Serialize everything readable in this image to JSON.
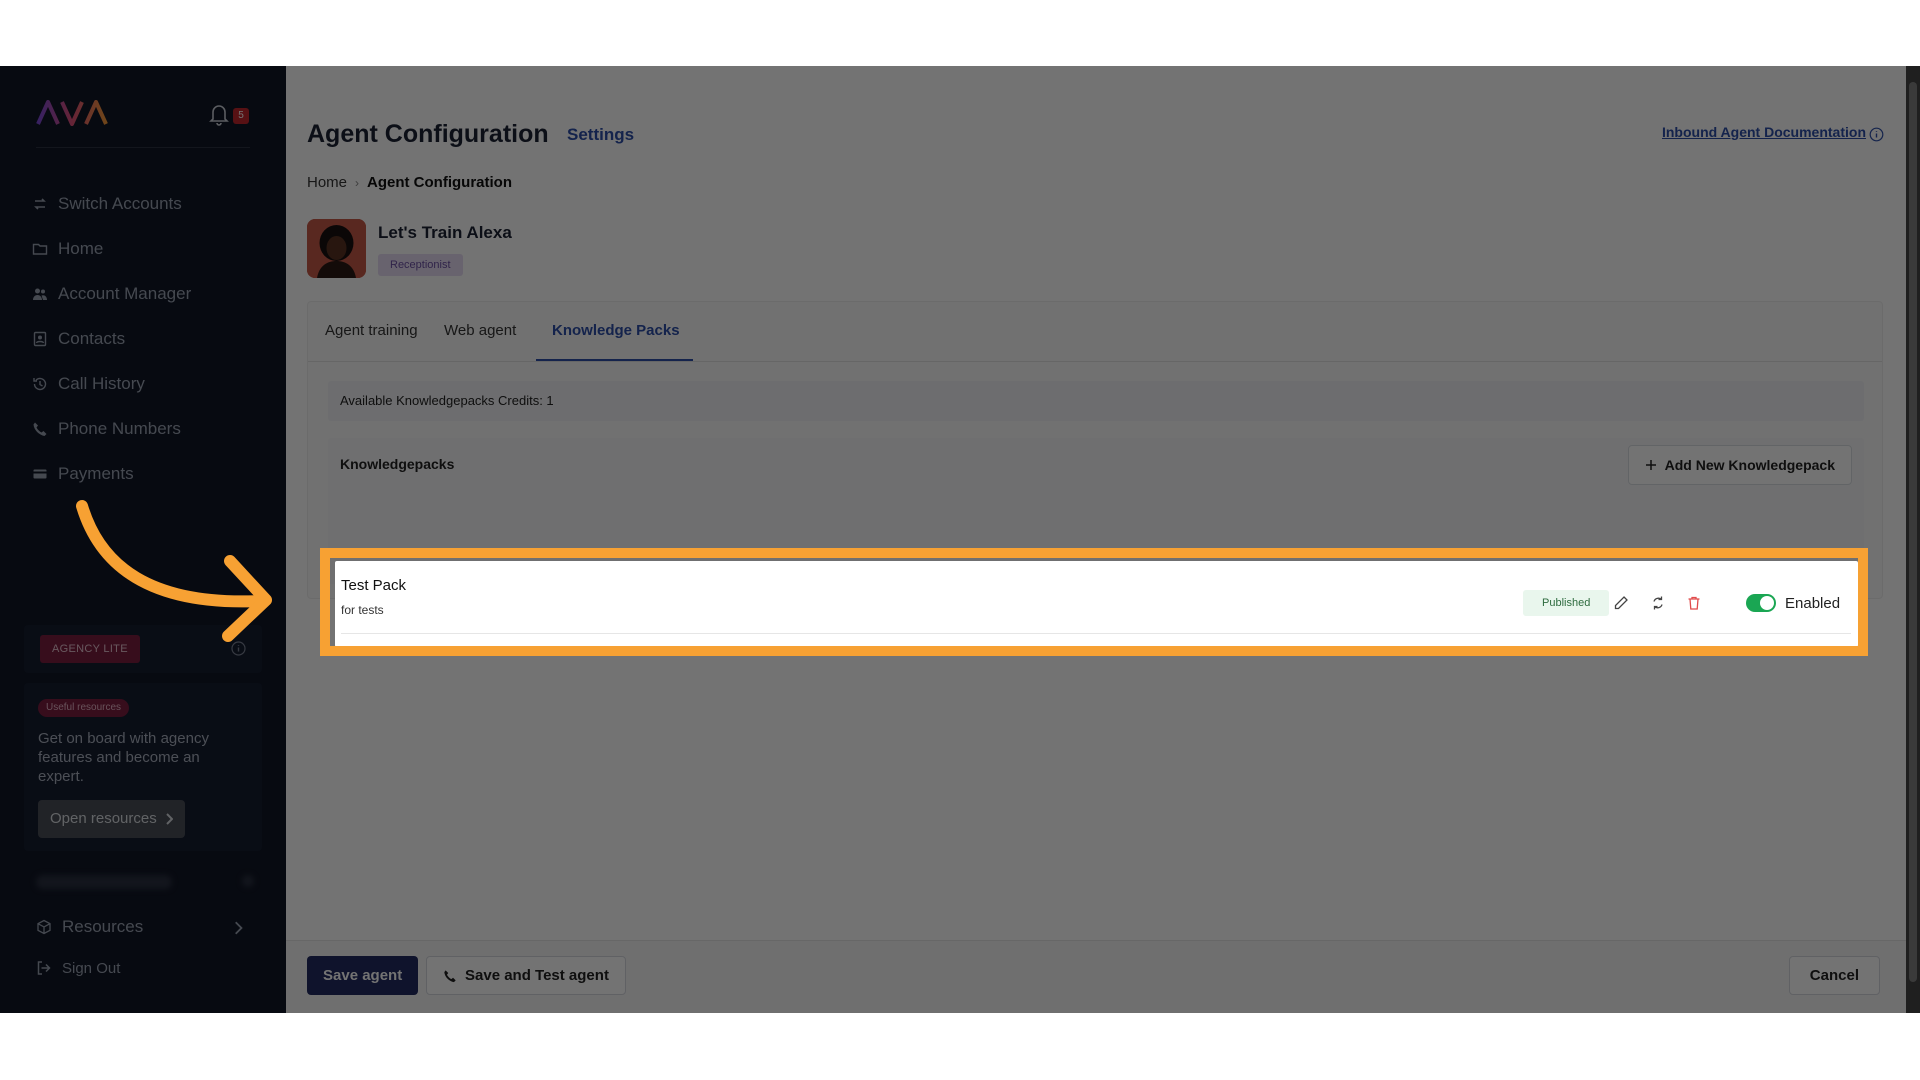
{
  "brand": {
    "logo_text": "AVA",
    "accent": "#f7a133",
    "primary": "#232b63",
    "link": "#2d4fa8"
  },
  "notifications": {
    "count": "5"
  },
  "sidebar": {
    "items": [
      {
        "label": "Switch Accounts",
        "icon": "switch-icon"
      },
      {
        "label": "Home",
        "icon": "folder-icon"
      },
      {
        "label": "Account Manager",
        "icon": "users-icon"
      },
      {
        "label": "Contacts",
        "icon": "contacts-icon"
      },
      {
        "label": "Call History",
        "icon": "history-icon"
      },
      {
        "label": "Phone Numbers",
        "icon": "phone-icon"
      },
      {
        "label": "Payments",
        "icon": "card-icon"
      }
    ],
    "plan_badge": "AGENCY LITE",
    "resources_card": {
      "badge": "Useful resources",
      "text": "Get on board with agency features and become an expert.",
      "button": "Open resources"
    },
    "resources": "Resources",
    "sign_out": "Sign Out"
  },
  "header": {
    "title": "Agent Configuration",
    "subtitle": "Settings",
    "doc_link": "Inbound Agent Documentation"
  },
  "breadcrumb": {
    "home": "Home",
    "current": "Agent Configuration"
  },
  "agent": {
    "name": "Let's Train Alexa",
    "role": "Receptionist"
  },
  "tabs": [
    {
      "label": "Agent training"
    },
    {
      "label": "Web agent"
    },
    {
      "label": "Knowledge Packs"
    }
  ],
  "knowledge": {
    "credits": "Available Knowledgepacks Credits: 1",
    "section_title": "Knowledgepacks",
    "add_button": "Add New Knowledgepack",
    "packs": [
      {
        "name": "Test Pack",
        "description": "for tests",
        "status": "Published",
        "toggle_label": "Enabled"
      }
    ]
  },
  "footer": {
    "save": "Save agent",
    "save_test": "Save and Test agent",
    "cancel": "Cancel"
  }
}
